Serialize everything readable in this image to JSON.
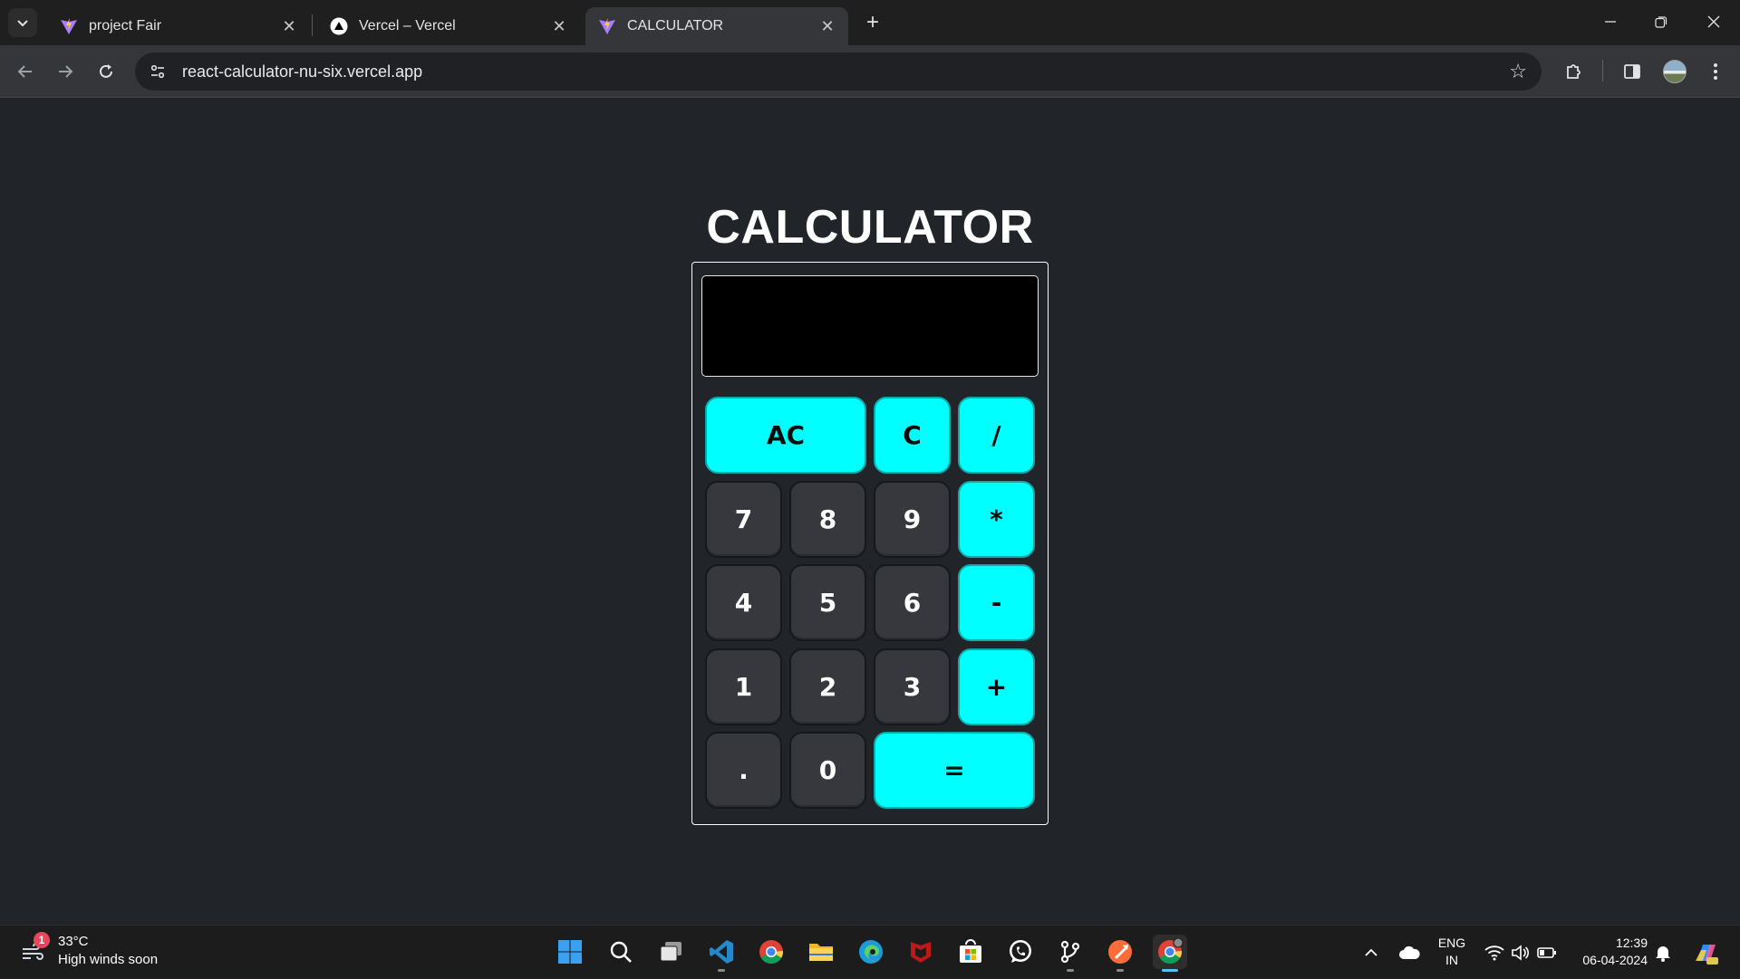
{
  "browser": {
    "tabs": [
      {
        "title": "project Fair",
        "active": false
      },
      {
        "title": "Vercel – Vercel",
        "active": false
      },
      {
        "title": "CALCULATOR",
        "active": true
      }
    ],
    "url": "react-calculator-nu-six.vercel.app"
  },
  "calculator": {
    "heading": "CALCULATOR",
    "display_value": "",
    "buttons": {
      "ac": "AC",
      "c": "C",
      "divide": "/",
      "seven": "7",
      "eight": "8",
      "nine": "9",
      "multiply": "*",
      "four": "4",
      "five": "5",
      "six": "6",
      "minus": "-",
      "one": "1",
      "two": "2",
      "three": "3",
      "plus": "+",
      "dot": ".",
      "zero": "0",
      "equals": "="
    },
    "colors": {
      "operator": "#00ffff",
      "number": "#36383d",
      "display": "#000000",
      "background": "#212429"
    }
  },
  "taskbar": {
    "weather": {
      "badge": "1",
      "temp": "33°C",
      "desc": "High winds soon"
    },
    "language": {
      "line1": "ENG",
      "line2": "IN"
    },
    "clock": {
      "time": "12:39",
      "date": "06-04-2024"
    }
  }
}
